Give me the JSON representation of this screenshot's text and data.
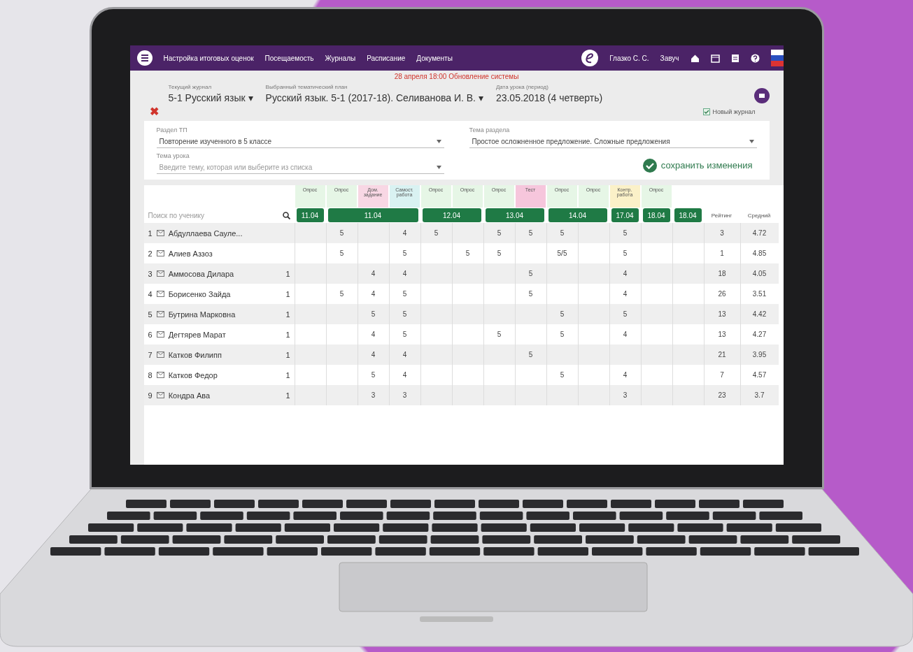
{
  "nav": {
    "items": [
      {
        "label": "Настройка итоговых оценок"
      },
      {
        "label": "Посещаемость"
      },
      {
        "label": "Журналы"
      },
      {
        "label": "Расписание"
      },
      {
        "label": "Документы"
      }
    ],
    "user": "Глазко С. С.",
    "role": "Завуч"
  },
  "notice": "28 апреля 18:00 Обновление системы",
  "selectors": [
    {
      "label": "Текущий журнал",
      "value": "5-1 Русский язык ▾"
    },
    {
      "label": "Выбранный тематический план",
      "value": "Русский язык. 5-1 (2017-18). Селиванова И. В. ▾"
    },
    {
      "label": "Дата урока (период)",
      "value": "23.05.2018 (4 четверть)"
    }
  ],
  "close": "✖",
  "new_journal": {
    "label": "Новый журнал",
    "checked": true
  },
  "form": {
    "fields": [
      {
        "label": "Раздел ТП",
        "value": "Повторение изученного в 5 классе"
      },
      {
        "label": "Тема раздела",
        "value": "Простое осложненное предложение. Сложные предложения"
      },
      {
        "label": "Тема урока",
        "placeholder": "Введите тему, которая или выберите из списка"
      }
    ],
    "save": "сохранить изменения"
  },
  "grades": {
    "search": {
      "placeholder": "Поиск по ученику"
    },
    "dates": [
      {
        "date": "11.04",
        "columns": [
          {
            "label": "Опрос",
            "color": "#e6f6e6"
          }
        ]
      },
      {
        "date": "11.04",
        "columns": [
          {
            "label": "Опрос",
            "color": "#e6f6e6"
          },
          {
            "label": "Дом. задание",
            "color": "#f8d7e4"
          },
          {
            "label": "Самост. работа",
            "color": "#d9f2f2"
          }
        ]
      },
      {
        "date": "12.04",
        "columns": [
          {
            "label": "Опрос",
            "color": "#e6f6e6"
          },
          {
            "label": "Опрос",
            "color": "#e6f6e6"
          }
        ]
      },
      {
        "date": "13.04",
        "columns": [
          {
            "label": "Опрос",
            "color": "#e6f6e6"
          },
          {
            "label": "Тест",
            "color": "#f6c6dc"
          }
        ]
      },
      {
        "date": "14.04",
        "columns": [
          {
            "label": "Опрос",
            "color": "#e6f6e6"
          },
          {
            "label": "Опрос",
            "color": "#e6f6e6"
          }
        ]
      },
      {
        "date": "17.04",
        "columns": [
          {
            "label": "Контр. работа",
            "color": "#fbf1c8"
          }
        ]
      },
      {
        "date": "18.04",
        "columns": [
          {
            "label": "Опрос",
            "color": "#e6f6e6"
          }
        ]
      },
      {
        "date": "18.04",
        "columns": [
          {
            "color": "#ffffff"
          }
        ]
      }
    ],
    "rating_header": "Рейтинг",
    "average_header": "Средний",
    "rows": [
      {
        "number": "1",
        "name": "Абдуллаева Сауле...",
        "grades": {
          "2": "5",
          "4": "4",
          "5": "5",
          "7": "5",
          "8": "5",
          "9": "5",
          "11": "5"
        },
        "rating": "3",
        "average": "4.72"
      },
      {
        "number": "2",
        "name": "Алиев Аззоз",
        "grades": {
          "2": "5",
          "4": "5",
          "6": "5",
          "7": "5",
          "9": "5/5",
          "11": "5"
        },
        "rating": "1",
        "average": "4.85"
      },
      {
        "number": "3",
        "name": "Аммосова Дилара",
        "mark": "1",
        "grades": {
          "3": "4",
          "4": "4",
          "8": "5",
          "11": "4"
        },
        "rating": "18",
        "average": "4.05"
      },
      {
        "number": "4",
        "name": "Борисенко Зайда",
        "mark": "1",
        "grades": {
          "2": "5",
          "3": "4",
          "4": "5",
          "8": "5",
          "11": "4"
        },
        "rating": "26",
        "average": "3.51"
      },
      {
        "number": "5",
        "name": "Бутрина Марковна",
        "mark": "1",
        "grades": {
          "3": "5",
          "4": "5",
          "9": "5",
          "11": "5"
        },
        "rating": "13",
        "average": "4.42"
      },
      {
        "number": "6",
        "name": "Дегтярев Марат",
        "mark": "1",
        "grades": {
          "3": "4",
          "4": "5",
          "7": "5",
          "9": "5",
          "11": "4"
        },
        "rating": "13",
        "average": "4.27"
      },
      {
        "number": "7",
        "name": "Катков Филипп",
        "mark": "1",
        "grades": {
          "3": "4",
          "4": "4",
          "8": "5"
        },
        "rating": "21",
        "average": "3.95"
      },
      {
        "number": "8",
        "name": "Катков Федор",
        "mark": "1",
        "grades": {
          "3": "5",
          "4": "4",
          "9": "5",
          "11": "4"
        },
        "rating": "7",
        "average": "4.57"
      },
      {
        "number": "9",
        "name": "Кондра Ава",
        "mark": "1",
        "grades": {
          "3": "3",
          "4": "3",
          "11": "3"
        },
        "rating": "23",
        "average": "3.7"
      }
    ]
  }
}
